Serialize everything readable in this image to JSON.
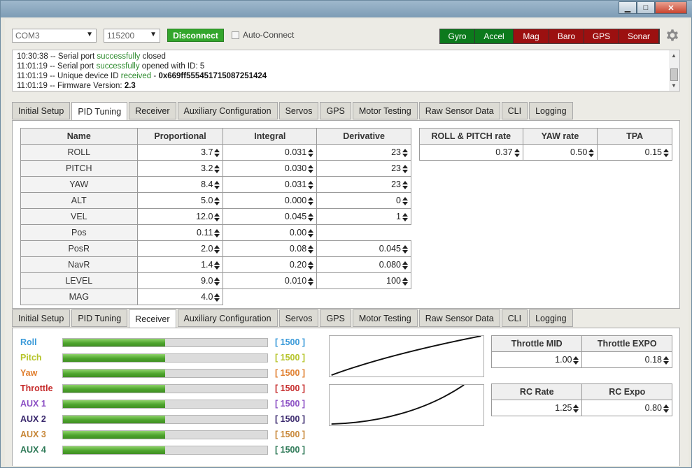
{
  "window": {
    "minimize_glyph": "▁",
    "maximize_glyph": "□",
    "close_glyph": "✕"
  },
  "topbar": {
    "port": "COM3",
    "baud": "115200",
    "disconnect_label": "Disconnect",
    "autoconnect_label": "Auto-Connect",
    "sensors": [
      {
        "label": "Gyro",
        "state": "on"
      },
      {
        "label": "Accel",
        "state": "on"
      },
      {
        "label": "Mag",
        "state": "off"
      },
      {
        "label": "Baro",
        "state": "off"
      },
      {
        "label": "GPS",
        "state": "off"
      },
      {
        "label": "Sonar",
        "state": "off"
      }
    ],
    "settings_icon": "gear-icon",
    "colors": {
      "connected": "#33a62c",
      "sensor_on": "#0c7a1c",
      "sensor_off": "#9c1010"
    }
  },
  "log": [
    {
      "a": "10:30:38 -- Serial port ",
      "g": "successfully",
      "b": " closed",
      "v": ""
    },
    {
      "a": "11:01:19 -- Serial port ",
      "g": "successfully",
      "b": " opened with ID: 5",
      "v": ""
    },
    {
      "a": "11:01:19 -- Unique device ID ",
      "g": "received",
      "b": " - ",
      "v": "0x669ff555451715087251424"
    },
    {
      "a": "11:01:19 -- Firmware Version: ",
      "g": "",
      "b": "",
      "v": "2.3"
    }
  ],
  "tabs": [
    "Initial Setup",
    "PID Tuning",
    "Receiver",
    "Auxiliary Configuration",
    "Servos",
    "GPS",
    "Motor Testing",
    "Raw Sensor Data",
    "CLI",
    "Logging"
  ],
  "pid": {
    "headers": [
      "Name",
      "Proportional",
      "Integral",
      "Derivative"
    ],
    "rows": [
      {
        "name": "ROLL",
        "p": "3.7",
        "i": "0.031",
        "d": "23"
      },
      {
        "name": "PITCH",
        "p": "3.2",
        "i": "0.030",
        "d": "23"
      },
      {
        "name": "YAW",
        "p": "8.4",
        "i": "0.031",
        "d": "23"
      },
      {
        "name": "ALT",
        "p": "5.0",
        "i": "0.000",
        "d": "0"
      },
      {
        "name": "VEL",
        "p": "12.0",
        "i": "0.045",
        "d": "1"
      },
      {
        "name": "Pos",
        "p": "0.11",
        "i": "0.00",
        "d": null
      },
      {
        "name": "PosR",
        "p": "2.0",
        "i": "0.08",
        "d": "0.045"
      },
      {
        "name": "NavR",
        "p": "1.4",
        "i": "0.20",
        "d": "0.080"
      },
      {
        "name": "LEVEL",
        "p": "9.0",
        "i": "0.010",
        "d": "100"
      },
      {
        "name": "MAG",
        "p": "4.0",
        "i": null,
        "d": null
      }
    ],
    "rates": {
      "headers": [
        "ROLL & PITCH rate",
        "YAW rate",
        "TPA"
      ],
      "values": [
        "0.37",
        "0.50",
        "0.15"
      ]
    }
  },
  "receiver": {
    "channels": [
      {
        "label": "Roll",
        "value": "[ 1500 ]",
        "color": "#3a9ad9",
        "level": 0.5
      },
      {
        "label": "Pitch",
        "value": "[ 1500 ]",
        "color": "#b5c42a",
        "level": 0.5
      },
      {
        "label": "Yaw",
        "value": "[ 1500 ]",
        "color": "#e07f2f",
        "level": 0.5
      },
      {
        "label": "Throttle",
        "value": "[ 1500 ]",
        "color": "#c62d2d",
        "level": 0.5
      },
      {
        "label": "AUX 1",
        "value": "[ 1500 ]",
        "color": "#8b4fc4",
        "level": 0.5
      },
      {
        "label": "AUX 2",
        "value": "[ 1500 ]",
        "color": "#3b2a6e",
        "level": 0.5
      },
      {
        "label": "AUX 3",
        "value": "[ 1500 ]",
        "color": "#c8883a",
        "level": 0.5
      },
      {
        "label": "AUX 4",
        "value": "[ 1500 ]",
        "color": "#2f7a58",
        "level": 0.5
      }
    ],
    "throttle": {
      "headers": [
        "Throttle MID",
        "Throttle EXPO"
      ],
      "values": [
        "1.00",
        "0.18"
      ]
    },
    "rc": {
      "headers": [
        "RC Rate",
        "RC Expo"
      ],
      "values": [
        "1.25",
        "0.80"
      ]
    }
  }
}
